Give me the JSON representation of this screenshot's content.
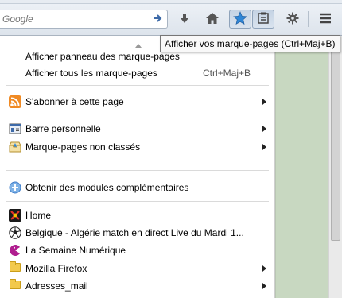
{
  "search": {
    "placeholder": "Google"
  },
  "tooltip": {
    "text": "Afficher vos marque-pages (Ctrl+Maj+B)"
  },
  "toolbar": {
    "buttons": [
      {
        "name": "download-icon"
      },
      {
        "name": "home-icon"
      },
      {
        "name": "bookmark-star-icon"
      },
      {
        "name": "bookmarks-menu-icon"
      },
      {
        "name": "gear-icon"
      },
      {
        "name": "hamburger-menu-icon"
      }
    ]
  },
  "menu": {
    "show_sidebar": "Afficher panneau des marque-pages",
    "show_all": "Afficher tous les marque-pages",
    "show_all_shortcut": "Ctrl+Maj+B",
    "subscribe": "S'abonner à cette page",
    "personal_bar": "Barre personnelle",
    "unsorted": "Marque-pages non classés",
    "addons": "Obtenir des modules complémentaires",
    "items": [
      {
        "label": "Home",
        "icon": "home-site-icon"
      },
      {
        "label": "Belgique - Algérie match en direct Live du Mardi 1...",
        "icon": "soccer-ball-icon"
      },
      {
        "label": "La Semaine Numérique",
        "icon": "semaine-numerique-icon"
      },
      {
        "label": "Mozilla Firefox",
        "icon": "folder-icon"
      },
      {
        "label": "Adresses_mail",
        "icon": "folder-icon"
      }
    ]
  },
  "colors": {
    "accent": "#3d7cc9",
    "rss": "#f08a24",
    "folder": "#f2c94c"
  }
}
